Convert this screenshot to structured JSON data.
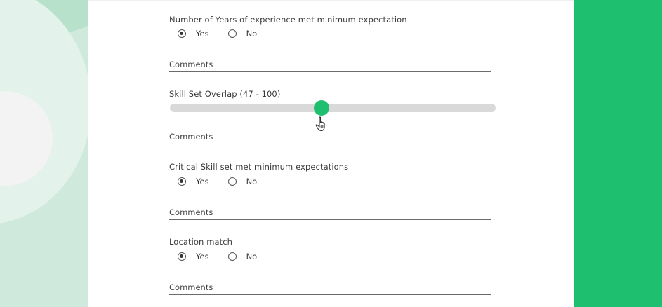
{
  "form": {
    "experience": {
      "question": "Number of Years of experience met minimum expectation",
      "yes_label": "Yes",
      "no_label": "No",
      "selected": "Yes",
      "comment_placeholder": "Comments"
    },
    "skill_overlap": {
      "label": "Skill Set Overlap (47 - 100)",
      "value": 47,
      "min": 0,
      "max": 100,
      "comment_placeholder": "Comments"
    },
    "critical_skill": {
      "question": "Critical Skill set met minimum expectations",
      "yes_label": "Yes",
      "no_label": "No",
      "selected": "Yes",
      "comment_placeholder": "Comments"
    },
    "location": {
      "question": "Location match",
      "yes_label": "Yes",
      "no_label": "No",
      "selected": "Yes",
      "comment_placeholder": "Comments"
    }
  },
  "colors": {
    "accent": "#1fbf70",
    "track": "#d9d9d9",
    "left_bg": "#cfe9dc"
  },
  "icons": {
    "cursor": "hand-pointer-icon"
  }
}
